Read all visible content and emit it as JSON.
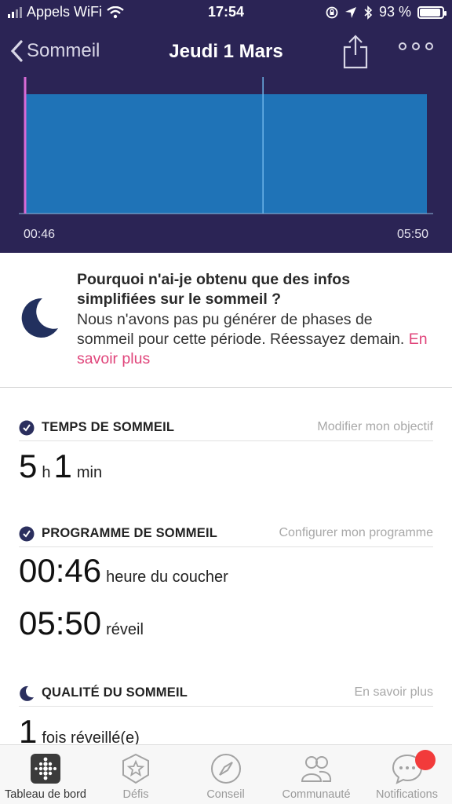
{
  "status_bar": {
    "carrier": "Appels WiFi",
    "time": "17:54",
    "battery": "93 %"
  },
  "nav": {
    "back_label": "Sommeil",
    "title": "Jeudi 1 Mars"
  },
  "chart_data": {
    "type": "area",
    "x_start": "00:46",
    "x_end": "05:50",
    "x_tick_labels": [
      "00:46",
      "05:50"
    ],
    "series": [
      {
        "values": [
          1,
          1
        ]
      }
    ],
    "markers": [
      "00:46",
      "03:46"
    ],
    "colors": {
      "fill": "#1f73b7",
      "background": "#2b2455",
      "start_marker": "#d86bd6",
      "mid_marker": "#6fb6ea"
    }
  },
  "info": {
    "title": "Pourquoi n'ai-je obtenu que des infos simplifiées sur le sommeil ?",
    "body": "Nous n'avons pas pu générer de phases de sommeil pour cette période. Réessayez demain.",
    "link": "En savoir plus"
  },
  "sleep_time": {
    "heading": "TEMPS DE SOMMEIL",
    "action": "Modifier mon objectif",
    "hours": "5",
    "hours_unit": "h",
    "minutes": "1",
    "minutes_unit": "min"
  },
  "schedule": {
    "heading": "PROGRAMME DE SOMMEIL",
    "action": "Configurer mon programme",
    "bedtime": "00:46",
    "bedtime_label": "heure du coucher",
    "wake": "05:50",
    "wake_label": "réveil"
  },
  "quality": {
    "heading": "QUALITÉ DU SOMMEIL",
    "action": "En savoir plus",
    "awake_count": "1",
    "awake_label": "fois réveillé(e)"
  },
  "tabs": [
    {
      "label": "Tableau de bord",
      "icon": "dashboard-icon"
    },
    {
      "label": "Défis",
      "icon": "challenges-badge-icon"
    },
    {
      "label": "Conseil",
      "icon": "compass-icon"
    },
    {
      "label": "Communauté",
      "icon": "community-people-icon"
    },
    {
      "label": "Notifications",
      "icon": "chat-bubble-icon"
    }
  ],
  "colors": {
    "header_bg": "#2b2455",
    "accent_link": "#e0457b",
    "badge": "#f23b3b"
  }
}
